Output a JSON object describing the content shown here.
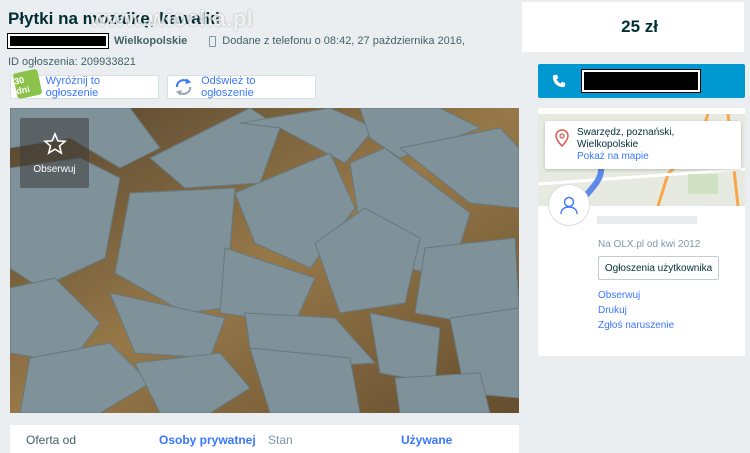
{
  "header": {
    "title": "Płytki na mozaikę, kawałki",
    "watermark": "www.wiocha.pl",
    "region": "Wielkopolskie",
    "added": "Dodane z telefonu o 08:42, 27 października 2016,",
    "ad_id": "ID ogłoszenia: 209933821"
  },
  "actions": {
    "badge_text": "30 dni",
    "highlight_label": "Wyróżnij to ogłoszenie",
    "refresh_label": "Odśwież to ogłoszenie"
  },
  "price": "25 zł",
  "gallery": {
    "observe_label": "Obserwuj"
  },
  "params": {
    "offer_label": "Oferta od",
    "offer_value": "Osoby prywatnej",
    "state_label": "Stan",
    "state_value": "Używane"
  },
  "seller": {
    "location_line1": "Swarzędz, poznański,",
    "location_line2": "Wielkopolskie",
    "map_link": "Pokaż na mapie",
    "since": "Na OLX.pl od kwi 2012",
    "user_ads_label": "Ogłoszenia użytkownika",
    "links": [
      "Obserwuj",
      "Drukuj",
      "Zgłoś naruszenie"
    ]
  },
  "colors": {
    "accent": "#0098d0",
    "link": "#3a77ff",
    "text": "#002f34"
  }
}
